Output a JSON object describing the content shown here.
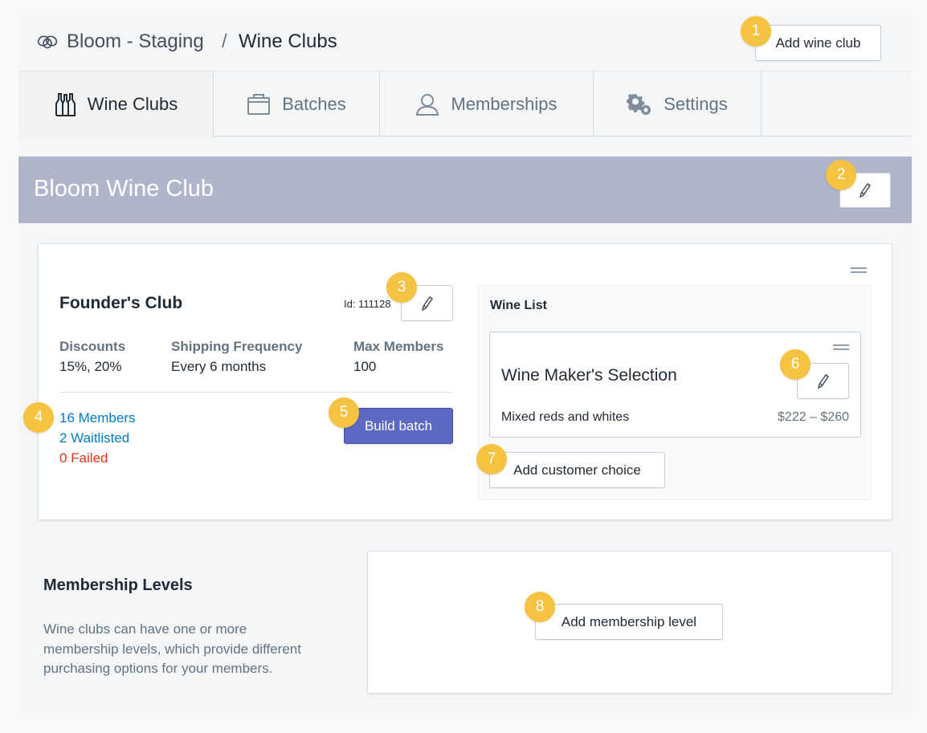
{
  "header": {
    "app_name": "Bloom - Staging",
    "separator": "/",
    "page_title": "Wine Clubs",
    "add_wine_club_label": "Add wine club"
  },
  "tabs": [
    {
      "label": "Wine Clubs",
      "icon": "wine-bottles-icon",
      "active": true
    },
    {
      "label": "Batches",
      "icon": "box-icon",
      "active": false
    },
    {
      "label": "Memberships",
      "icon": "user-icon",
      "active": false
    },
    {
      "label": "Settings",
      "icon": "gears-icon",
      "active": false
    }
  ],
  "club": {
    "name": "Bloom Wine Club"
  },
  "level": {
    "name": "Founder's Club",
    "id_text": "Id: 111128",
    "discounts_label": "Discounts",
    "discounts_value": "15%, 20%",
    "shipping_label": "Shipping Frequency",
    "shipping_value": "Every 6 months",
    "max_label": "Max Members",
    "max_value": "100",
    "members_link": "16 Members",
    "waitlisted_link": "2 Waitlisted",
    "failed_link": "0 Failed",
    "build_batch_label": "Build batch"
  },
  "wine_list": {
    "title": "Wine List",
    "choice_name": "Wine Maker's Selection",
    "choice_description": "Mixed reds and whites",
    "choice_price": "$222 – $260",
    "add_choice_label": "Add customer choice"
  },
  "membership_levels": {
    "title": "Membership Levels",
    "description": "Wine clubs can have one or more membership levels, which provide different purchasing options for your members.",
    "add_label": "Add membership level"
  },
  "markers": [
    "1",
    "2",
    "3",
    "4",
    "5",
    "6",
    "7",
    "8"
  ],
  "colors": {
    "primary": "#5c6ac4",
    "banner": "#b1b5cc",
    "link": "#007ace",
    "failed": "#de3618",
    "marker": "#f5c242"
  }
}
